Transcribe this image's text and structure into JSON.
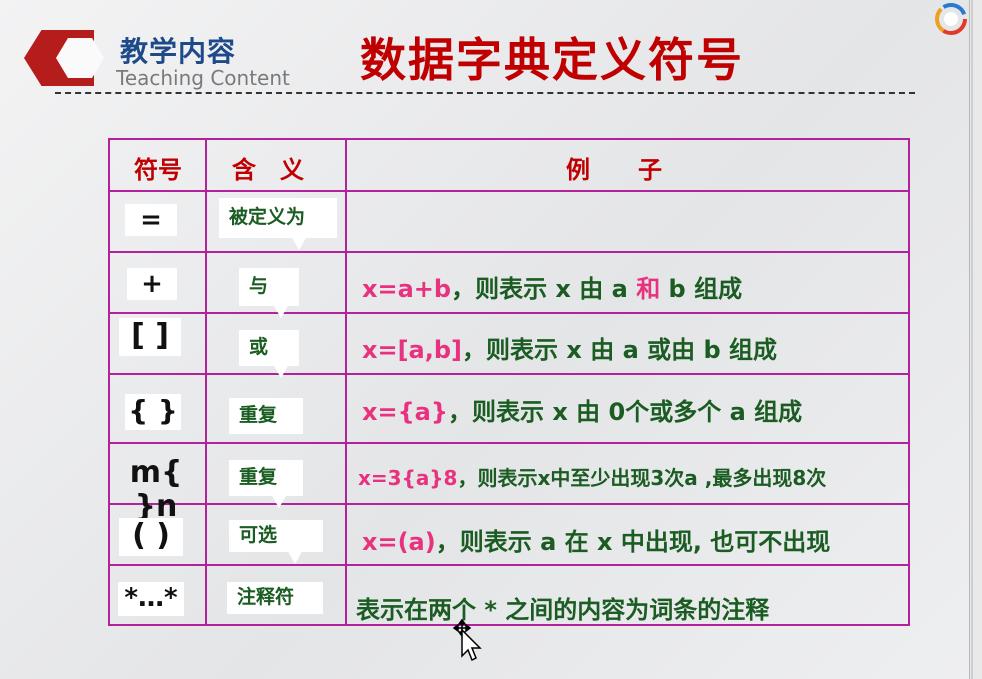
{
  "header": {
    "section_cn": "教学内容",
    "section_en": "Teaching Content",
    "title": "数据字典定义符号"
  },
  "table": {
    "headers": [
      "符号",
      "含　义",
      "例　　子"
    ],
    "rows": [
      {
        "symbol": "=",
        "meaning": "被定义为",
        "example": []
      },
      {
        "symbol": "+",
        "meaning": "与",
        "example": [
          [
            "x=a+b",
            "pink"
          ],
          [
            "，则表示 x 由 a ",
            ""
          ],
          [
            "和",
            "pink"
          ],
          [
            " b 组成",
            ""
          ]
        ]
      },
      {
        "symbol": "[  ]",
        "meaning": "或",
        "example": [
          [
            "x=[a,b]",
            "pink"
          ],
          [
            "，则表示 x 由 a 或由 b 组成",
            ""
          ]
        ]
      },
      {
        "symbol": "{  }",
        "meaning": "重复",
        "example": [
          [
            "x={a}",
            "pink"
          ],
          [
            "，则表示 x 由 0个或多个 a 组成",
            ""
          ]
        ]
      },
      {
        "symbol": "m{  }n",
        "meaning": "重复",
        "example": [
          [
            "x=3{a}8",
            "pink"
          ],
          [
            "，则表示x中至少出现3次a ,最多出现8次",
            ""
          ]
        ]
      },
      {
        "symbol": "(    )",
        "meaning": "可选",
        "example": [
          [
            "x=(a)",
            "pink"
          ],
          [
            "，则表示 a 在 x 中出现, 也可不出现",
            ""
          ]
        ]
      },
      {
        "symbol": "*…*",
        "meaning": "注释符",
        "example": [
          [
            "表示在两个 * 之间的内容为词条的注释",
            ""
          ]
        ]
      }
    ]
  },
  "colors": {
    "title_red": "#c00000",
    "border_magenta": "#b2229a",
    "text_green": "#1a5c22",
    "highlight_pink": "#e8327f",
    "brand_blue": "#1e4a8a"
  },
  "icons": [
    "app-logo-icon",
    "mouse-cursor-icon"
  ]
}
